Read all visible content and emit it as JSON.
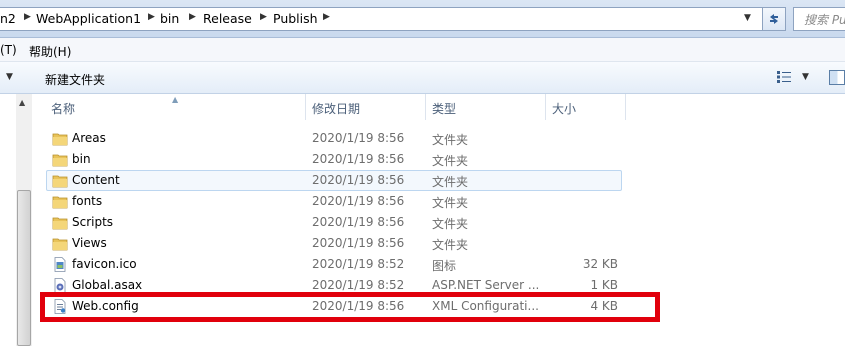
{
  "address": {
    "crumbs": [
      "n2",
      "WebApplication1",
      "bin",
      "Release",
      "Publish"
    ],
    "search_placeholder": "搜索 Pu"
  },
  "menu": {
    "items": [
      "(T)",
      "帮助(H)"
    ]
  },
  "toolbar": {
    "new_folder": "新建文件夹"
  },
  "columns": {
    "name": "名称",
    "date": "修改日期",
    "type": "类型",
    "size": "大小"
  },
  "files": [
    {
      "name": "Areas",
      "date": "2020/1/19 8:56",
      "type": "文件夹",
      "size": "",
      "icon": "folder-icon"
    },
    {
      "name": "bin",
      "date": "2020/1/19 8:56",
      "type": "文件夹",
      "size": "",
      "icon": "folder-icon"
    },
    {
      "name": "Content",
      "date": "2020/1/19 8:56",
      "type": "文件夹",
      "size": "",
      "icon": "folder-icon"
    },
    {
      "name": "fonts",
      "date": "2020/1/19 8:56",
      "type": "文件夹",
      "size": "",
      "icon": "folder-icon"
    },
    {
      "name": "Scripts",
      "date": "2020/1/19 8:56",
      "type": "文件夹",
      "size": "",
      "icon": "folder-icon"
    },
    {
      "name": "Views",
      "date": "2020/1/19 8:56",
      "type": "文件夹",
      "size": "",
      "icon": "folder-icon"
    },
    {
      "name": "favicon.ico",
      "date": "2020/1/19 8:52",
      "type": "图标",
      "size": "32 KB",
      "icon": "image-file-icon"
    },
    {
      "name": "Global.asax",
      "date": "2020/1/19 8:52",
      "type": "ASP.NET Server ...",
      "size": "1 KB",
      "icon": "asax-file-icon"
    },
    {
      "name": "Web.config",
      "date": "2020/1/19 8:56",
      "type": "XML Configurati...",
      "size": "4 KB",
      "icon": "config-file-icon"
    }
  ],
  "colors": {
    "highlight": "#e1000c",
    "folder": "#e8c35a",
    "hover_row": "#f3f8fd"
  }
}
